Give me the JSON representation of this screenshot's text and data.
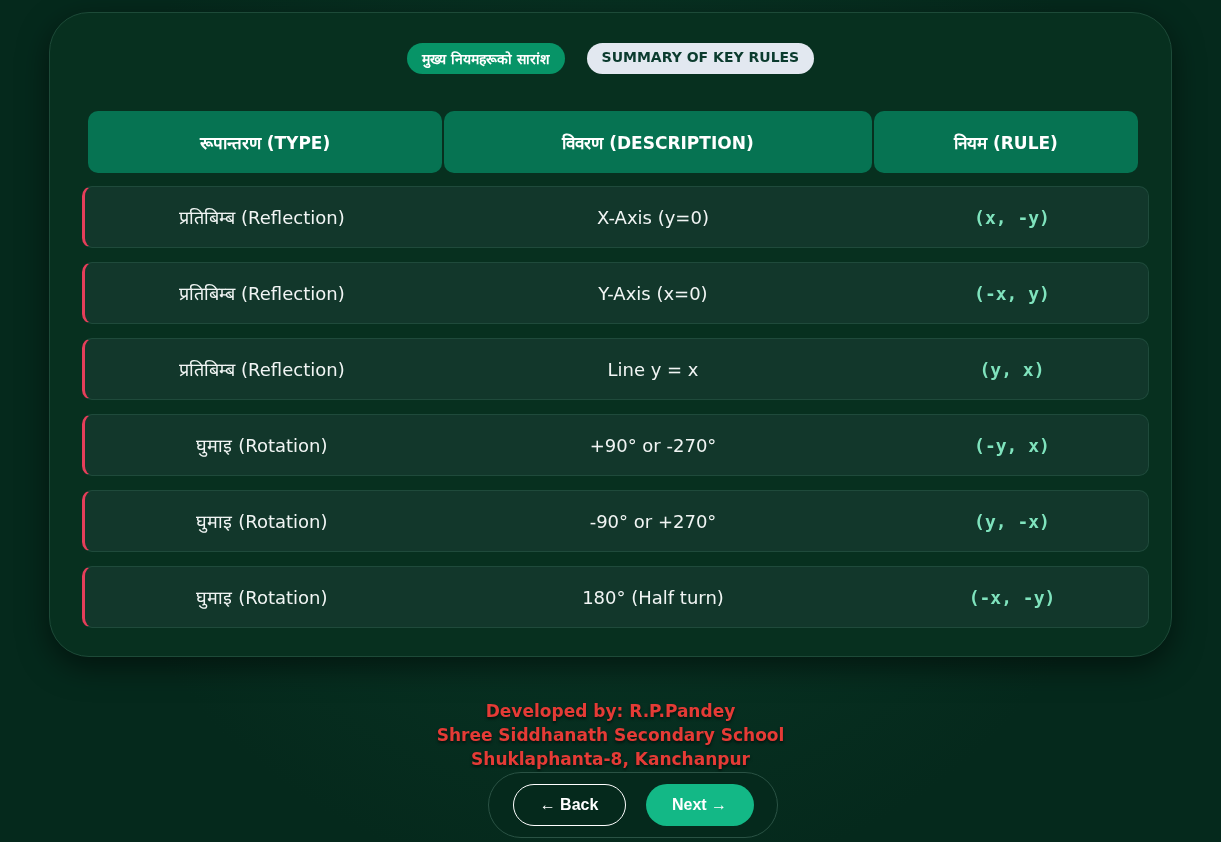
{
  "badges": [
    {
      "label": "मुख्य नियमहरूको सारांश",
      "kind": "primary"
    },
    {
      "label": "SUMMARY OF KEY RULES",
      "kind": "secondary"
    }
  ],
  "table": {
    "columns": [
      "रूपान्तरण (TYPE)",
      "विवरण (DESCRIPTION)",
      "नियम (RULE)"
    ],
    "rows": [
      {
        "type": "प्रतिबिम्ब (Reflection)",
        "description": "X-Axis (y=0)",
        "rule": "(x, -y)"
      },
      {
        "type": "प्रतिबिम्ब (Reflection)",
        "description": "Y-Axis (x=0)",
        "rule": "(-x, y)"
      },
      {
        "type": "प्रतिबिम्ब (Reflection)",
        "description": "Line y = x",
        "rule": "(y, x)"
      },
      {
        "type": "घुमाइ (Rotation)",
        "description": "+90° or -270°",
        "rule": "(-y, x)"
      },
      {
        "type": "घुमाइ (Rotation)",
        "description": "-90° or +270°",
        "rule": "(y, -x)"
      },
      {
        "type": "घुमाइ (Rotation)",
        "description": "180° (Half turn)",
        "rule": "(-x, -y)"
      }
    ]
  },
  "footer": {
    "credit": "Developed by: **R.P.Pandey**",
    "school": "Shree Siddhanath Secondary School",
    "address": "Shuklaphanta-8, Kanchanpur"
  },
  "nav": {
    "back": "← Back",
    "next": "Next →"
  }
}
